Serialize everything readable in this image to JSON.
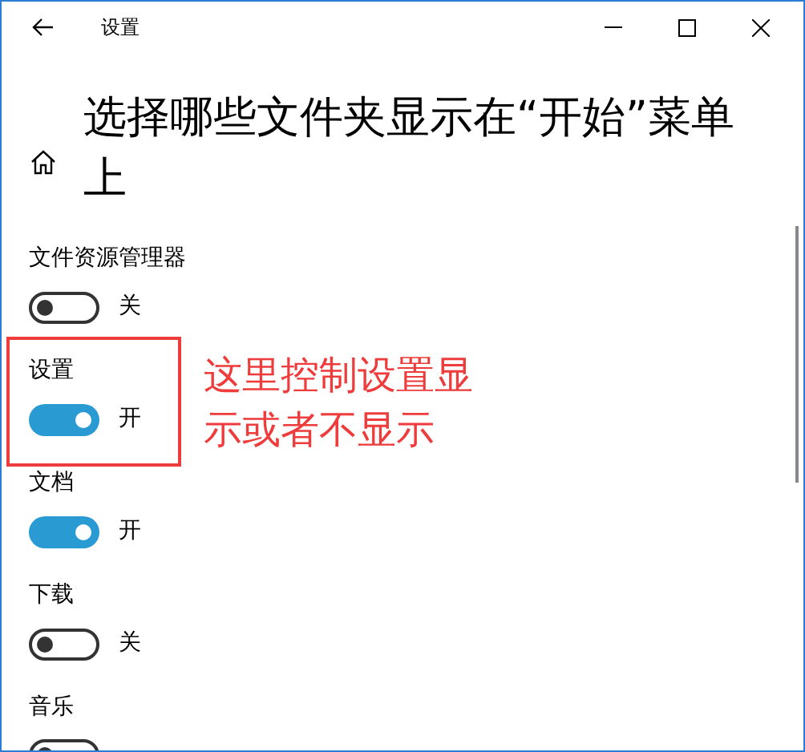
{
  "window": {
    "title": "设置"
  },
  "page": {
    "heading": "选择哪些文件夹显示在“开始”菜单上"
  },
  "folders": [
    {
      "label": "文件资源管理器",
      "on": false,
      "state_text": "关"
    },
    {
      "label": "设置",
      "on": true,
      "state_text": "开"
    },
    {
      "label": "文档",
      "on": true,
      "state_text": "开"
    },
    {
      "label": "下载",
      "on": false,
      "state_text": "关"
    },
    {
      "label": "音乐",
      "on": false
    }
  ],
  "annotation": {
    "text": "这里控制设置显示或者不显示"
  }
}
